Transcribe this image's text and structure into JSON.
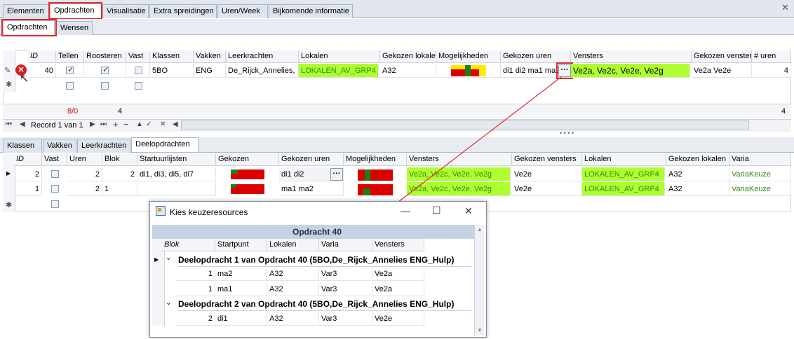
{
  "top_tabs": [
    "Elementen",
    "Opdrachten",
    "Visualisatie",
    "Extra spreidingen",
    "Uren/Week",
    "Bijkomende informatie"
  ],
  "sub_tabs": [
    "Opdrachten",
    "Wensen"
  ],
  "main_grid": {
    "headers": [
      "ID",
      "Tellen",
      "Roosteren",
      "Vast",
      "Klassen",
      "Vakken",
      "Leerkrachten",
      "Lokalen",
      "Gekozen lokalen",
      "Mogelijkheden",
      "Gekozen uren",
      "Vensters",
      "Gekozen vensters",
      "# uren"
    ],
    "row": {
      "id": "40",
      "klassen": "5BO",
      "vakken": "ENG",
      "leerkrachten": "De_Rijck_Annelies,",
      "lokalen": "LOKALEN_AV_GRP4",
      "gekozen_lokalen": "A32",
      "gekozen_uren": "di1 di2 ma1 ma2",
      "vensters": "Ve2a, Ve2c, Ve2e, Ve2g",
      "gekozen_vensters": "Ve2a Ve2e",
      "uren": "4"
    },
    "footer": {
      "count": "8/0",
      "total": "4",
      "right_total": "4"
    }
  },
  "nav": {
    "record_label": "Record 1 van 1"
  },
  "detail_tabs": [
    "Klassen",
    "Vakken",
    "Leerkrachten",
    "Deelopdrachten"
  ],
  "detail_grid": {
    "headers": [
      "ID",
      "Vast",
      "Uren",
      "Blok",
      "Startuurlijsten",
      "Gekozen",
      "Gekozen uren",
      "Mogelijkheden",
      "Vensters",
      "Gekozen vensters",
      "Lokalen",
      "Gekozen lokalen",
      "Varia"
    ],
    "rows": [
      {
        "id": "2",
        "uren": "2",
        "blok": "2",
        "start": "di1, di3, di5, di7",
        "gek_uren": "di1 di2",
        "vensters": "Ve2a, Ve2c, Ve2e, Ve2g",
        "gek_vensters": "Ve2e",
        "lokalen": "LOKALEN_AV_GRP4",
        "gek_lokalen": "A32",
        "varia": "VariaKeuze"
      },
      {
        "id": "1",
        "uren": "2",
        "blok": "1",
        "start": "",
        "gek_uren": "ma1 ma2",
        "vensters": "Ve2a, Ve2c, Ve2e, Ve2g",
        "gek_vensters": "Ve2e",
        "lokalen": "LOKALEN_AV_GRP4",
        "gek_lokalen": "A32",
        "varia": "VariaKeuze"
      }
    ]
  },
  "dialog": {
    "title": "Kies keuzeresources",
    "band": "Opdracht 40",
    "headers": [
      "Blok",
      "Startpunt",
      "Lokalen",
      "Varia",
      "Vensters"
    ],
    "groups": [
      {
        "label": "Deelopdracht 1 van Opdracht 40 (5BO,De_Rijck_Annelies ENG_Hulp)",
        "rows": [
          {
            "blok": "1",
            "start": "ma2",
            "lokalen": "A32",
            "varia": "Var3",
            "vensters": "Ve2a"
          },
          {
            "blok": "1",
            "start": "ma1",
            "lokalen": "A32",
            "varia": "Var3",
            "vensters": "Ve2a"
          }
        ]
      },
      {
        "label": "Deelopdracht 2 van Opdracht 40 (5BO,De_Rijck_Annelies ENG_Hulp)",
        "rows": [
          {
            "blok": "2",
            "start": "di1",
            "lokalen": "A32",
            "varia": "Var3",
            "vensters": "Ve2e"
          }
        ]
      }
    ]
  },
  "colors": {
    "highlight": "#adff2f",
    "annotation": "#e5292a",
    "band": "#c5d2e3"
  }
}
